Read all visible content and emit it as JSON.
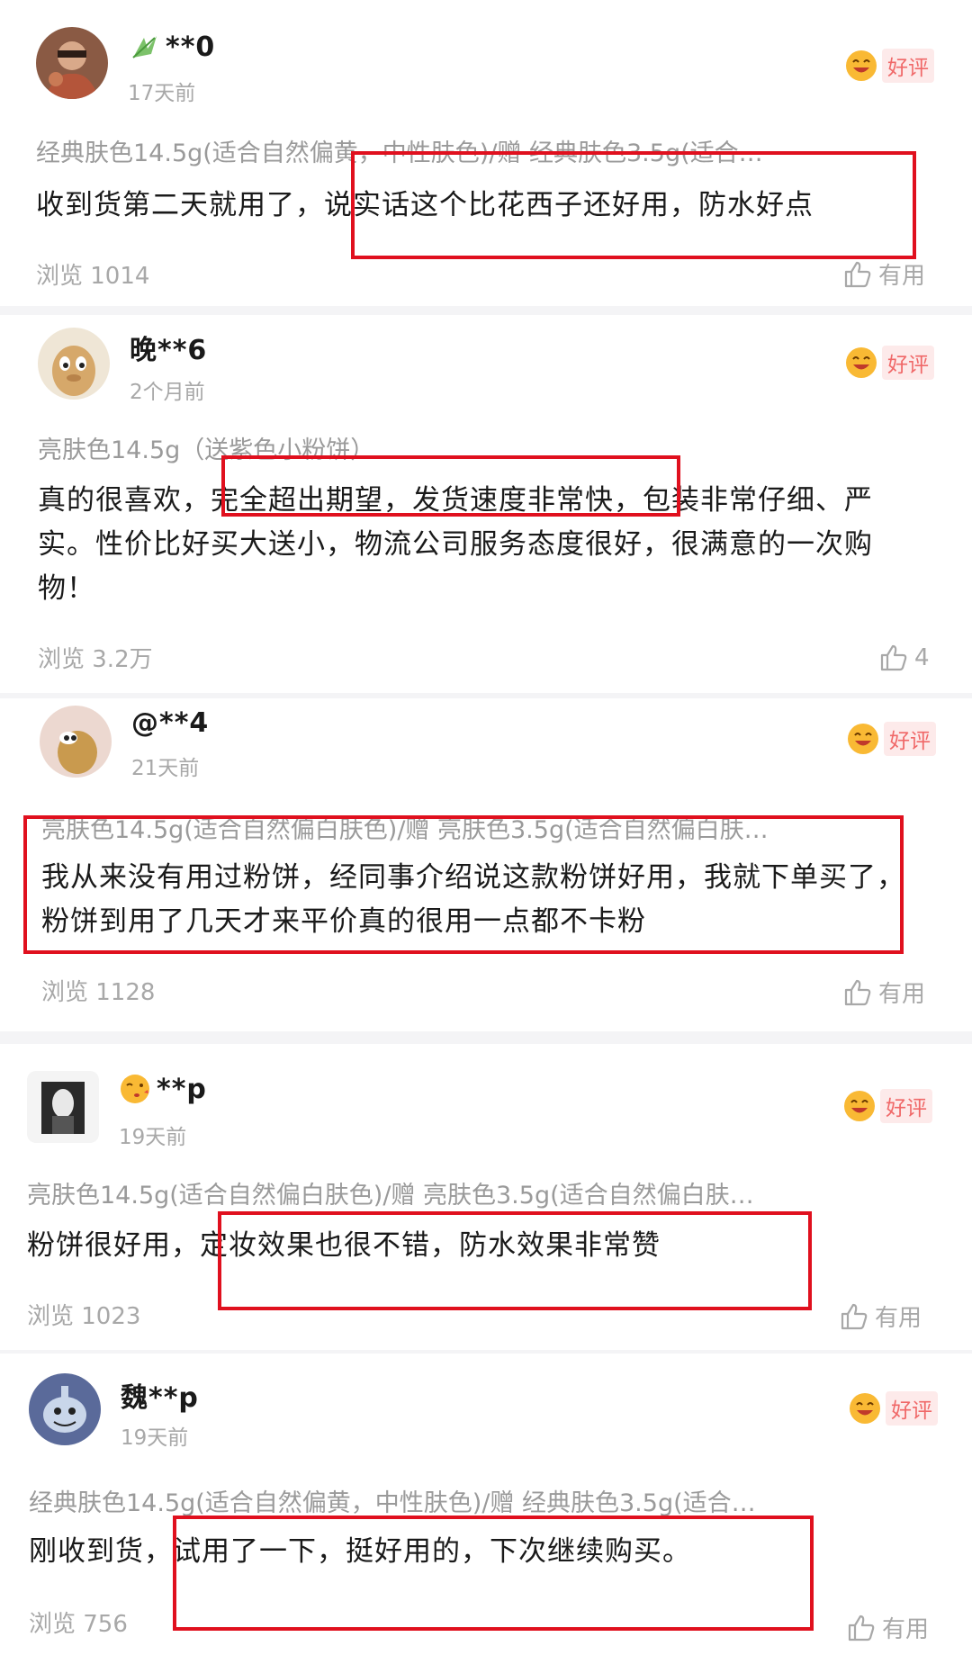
{
  "reviews": [
    {
      "name": "**0",
      "time": "17天前",
      "badge": "好评",
      "spec": "经典肤色14.5g(适合自然偏黄，中性肤色)/赠 经典肤色3.5g(适合…",
      "content": "收到货第二天就用了，说实话这个比花西子还好用，防水好点",
      "views": "浏览 1014",
      "like": "有用"
    },
    {
      "name": "晚**6",
      "time": "2个月前",
      "badge": "好评",
      "spec": "亮肤色14.5g（送紫色小粉饼）",
      "content": "真的很喜欢，完全超出期望，发货速度非常快，包装非常仔细、严实。性价比好买大送小，物流公司服务态度很好，很满意的一次购物！",
      "views": "浏览 3.2万",
      "like": "4"
    },
    {
      "name": "@**4",
      "time": "21天前",
      "badge": "好评",
      "spec": "亮肤色14.5g(适合自然偏白肤色)/赠 亮肤色3.5g(适合自然偏白肤…",
      "content": "我从来没有用过粉饼，经同事介绍说这款粉饼好用，我就下单买了，粉饼到用了几天才来平价真的很用一点都不卡粉",
      "views": "浏览 1128",
      "like": "有用"
    },
    {
      "name": "**p",
      "time": "19天前",
      "badge": "好评",
      "spec": "亮肤色14.5g(适合自然偏白肤色)/赠 亮肤色3.5g(适合自然偏白肤…",
      "content": "粉饼很好用，定妆效果也很不错，防水效果非常赞",
      "views": "浏览 1023",
      "like": "有用"
    },
    {
      "name": "魏**p",
      "time": "19天前",
      "badge": "好评",
      "spec": "经典肤色14.5g(适合自然偏黄，中性肤色)/赠 经典肤色3.5g(适合…",
      "content": "刚收到货，试用了一下，挺好用的，下次继续购买。",
      "views": "浏览 756",
      "like": "有用"
    }
  ]
}
